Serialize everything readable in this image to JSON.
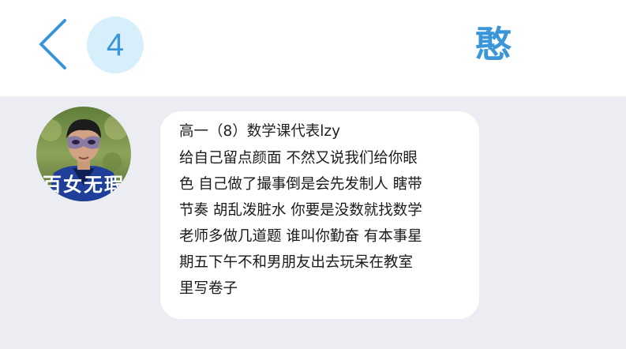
{
  "header": {
    "back_icon": "chevron-left-icon",
    "unread_count": "4",
    "title": "憨"
  },
  "message": {
    "avatar_caption": "百女无瑕",
    "sender": "高一（8）数学课代表lzy",
    "lines": [
      "给自己留点颜面 不然又说我们给你眼",
      "色 自己做了撮事倒是会先发制人 瞎带",
      "节奏 胡乱泼脏水 你要是没数就找数学",
      "老师多做几道题 谁叫你勤奋 有本事星",
      "期五下午不和男朋友出去玩呆在教室",
      "里写卷子"
    ]
  },
  "colors": {
    "accent": "#3a96d9",
    "badge_bg": "#d7eefb",
    "chat_bg": "#ecedf2",
    "bubble_bg": "#ffffff"
  }
}
